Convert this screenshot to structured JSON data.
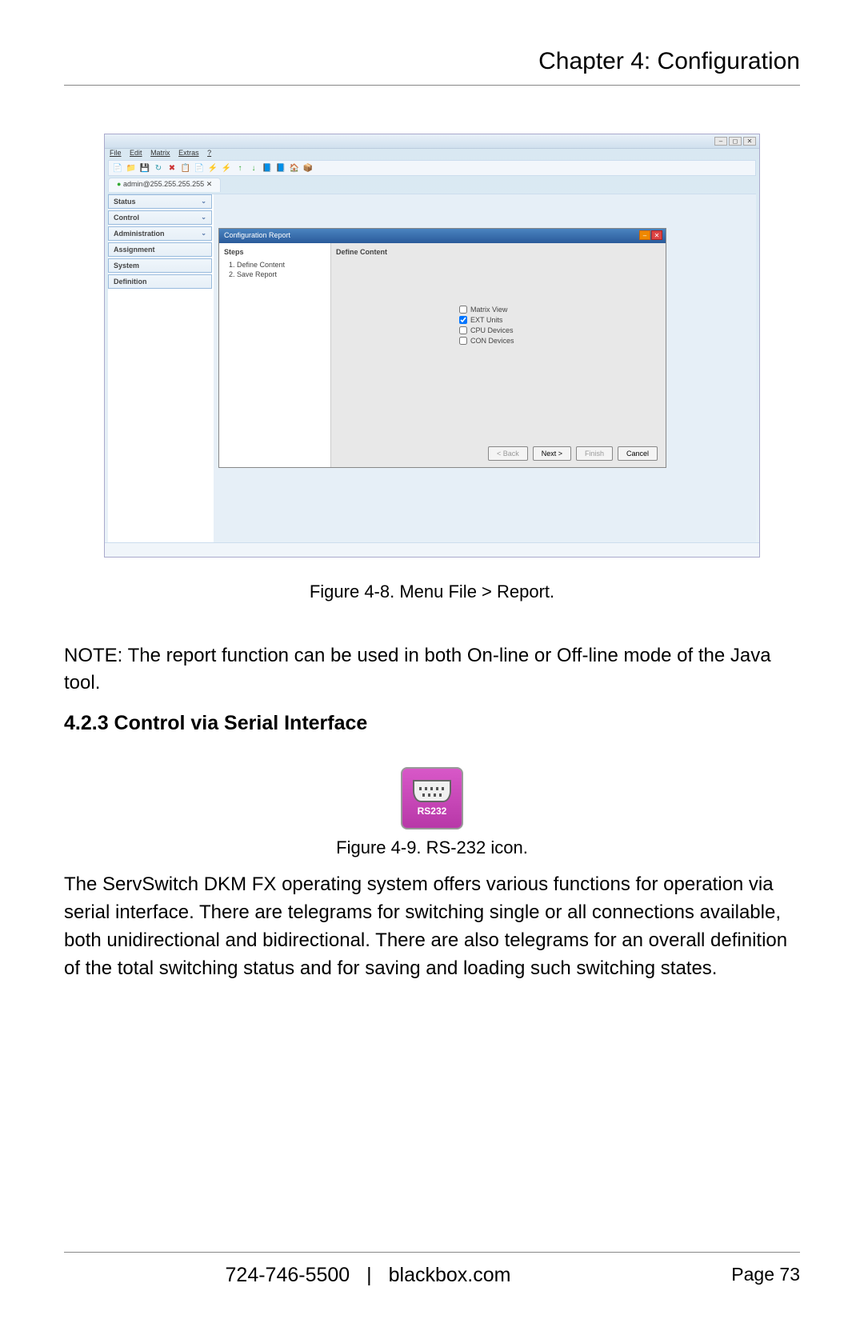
{
  "header": {
    "title": "Chapter 4: Configuration"
  },
  "screenshot": {
    "menus": [
      "File",
      "Edit",
      "Matrix",
      "Extras",
      "?"
    ],
    "tab": "admin@255.255.255.255",
    "sidebar": [
      {
        "label": "Status"
      },
      {
        "label": "Control"
      },
      {
        "label": "Administration"
      },
      {
        "label": "Assignment"
      },
      {
        "label": "System"
      },
      {
        "label": "Definition"
      }
    ],
    "dialog": {
      "title": "Configuration Report",
      "steps_header": "Steps",
      "steps": [
        "Define Content",
        "Save Report"
      ],
      "content_header": "Define Content",
      "checks": [
        {
          "label": "Matrix View",
          "checked": false
        },
        {
          "label": "EXT Units",
          "checked": true
        },
        {
          "label": "CPU Devices",
          "checked": false
        },
        {
          "label": "CON Devices",
          "checked": false
        }
      ],
      "buttons": {
        "back": "< Back",
        "next": "Next >",
        "finish": "Finish",
        "cancel": "Cancel"
      }
    }
  },
  "figure1_caption": "Figure 4-8. Menu File > Report.",
  "note_text": "NOTE: The report function can be used in both On-line or Off-line mode of the Java tool.",
  "section_heading": "4.2.3 Control via Serial Interface",
  "rs232_text": "RS232",
  "figure2_caption": "Figure 4-9. RS-232 icon.",
  "body_paragraph": "The ServSwitch DKM FX operating system offers various functions for operation via serial interface. There are telegrams for switching single or all connections available, both unidirectional and bidirectional. There are also telegrams for an overall definition of the total switching status and for saving and loading such switching states.",
  "footer": {
    "phone": "724-746-5500",
    "site": "blackbox.com",
    "page": "Page 73"
  }
}
